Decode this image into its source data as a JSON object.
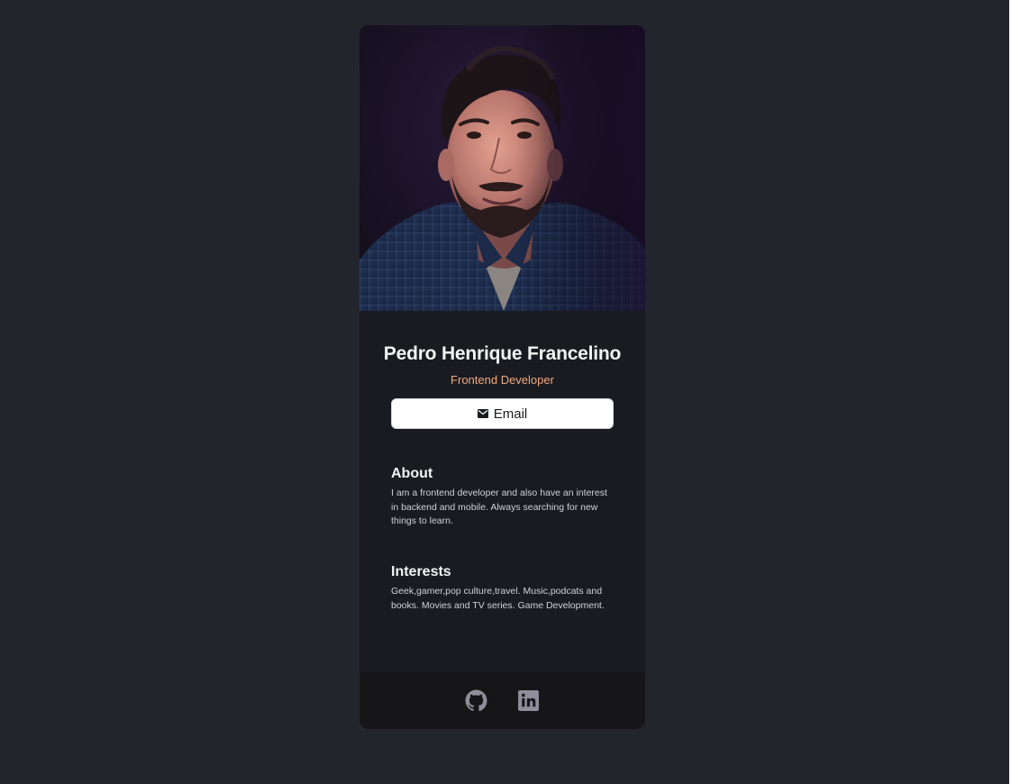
{
  "profile": {
    "name": "Pedro Henrique Francelino",
    "role": "Frontend Developer",
    "photo_alt": "Pedro Henrique Francelino"
  },
  "actions": {
    "email_label": "Email",
    "email_icon": "mail-icon"
  },
  "about": {
    "title": "About",
    "text": "I am a frontend developer and also have an interest in backend and mobile. Always searching for new things to learn."
  },
  "interests": {
    "title": "Interests",
    "text": "Geek,gamer,pop culture,travel. Music,podcats and books. Movies and TV series. Game Development."
  },
  "footer": {
    "links": [
      {
        "icon": "github-icon"
      },
      {
        "icon": "linkedin-icon"
      }
    ]
  },
  "colors": {
    "page_background": "#23252c",
    "card_background": "#1a1b21",
    "footer_background": "#161619",
    "accent": "#f0a97e",
    "icon": "#918e9b"
  }
}
